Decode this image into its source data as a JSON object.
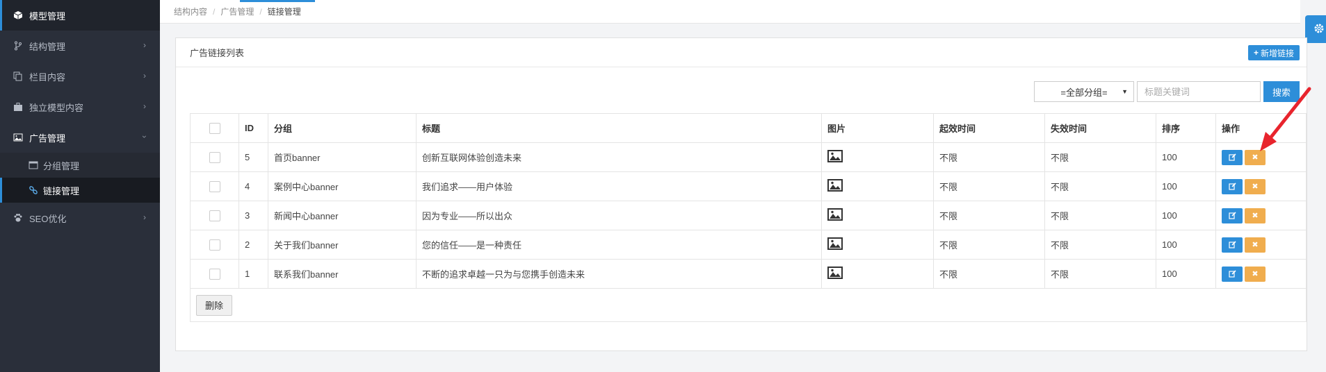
{
  "sidebar": {
    "items": [
      {
        "label": "模型管理",
        "icon": "cube-icon"
      },
      {
        "label": "结构管理",
        "icon": "branch-icon"
      },
      {
        "label": "栏目内容",
        "icon": "copy-icon"
      },
      {
        "label": "独立模型内容",
        "icon": "briefcase-icon"
      },
      {
        "label": "广告管理",
        "icon": "picture-icon"
      },
      {
        "label": "SEO优化",
        "icon": "paw-icon"
      }
    ],
    "sub_items": [
      {
        "label": "分组管理",
        "icon": "window-icon"
      },
      {
        "label": "链接管理",
        "icon": "link-icon"
      }
    ]
  },
  "breadcrumb": [
    "结构内容",
    "广告管理",
    "链接管理"
  ],
  "breadcrumb_sep": "/",
  "panel": {
    "title": "广告链接列表",
    "add_label": "新增链接"
  },
  "filter": {
    "group_selected": "=全部分组=",
    "placeholder": "标题关键词",
    "search_label": "搜索"
  },
  "table": {
    "headers": [
      "ID",
      "分组",
      "标题",
      "图片",
      "起效时间",
      "失效时间",
      "排序",
      "操作"
    ],
    "rows": [
      {
        "id": "5",
        "group": "首页banner",
        "title": "创新互联网体验创造未来",
        "start": "不限",
        "end": "不限",
        "sort": "100"
      },
      {
        "id": "4",
        "group": "案例中心banner",
        "title": "我们追求——用户体验",
        "start": "不限",
        "end": "不限",
        "sort": "100"
      },
      {
        "id": "3",
        "group": "新闻中心banner",
        "title": "因为专业——所以出众",
        "start": "不限",
        "end": "不限",
        "sort": "100"
      },
      {
        "id": "2",
        "group": "关于我们banner",
        "title": "您的信任——是一种责任",
        "start": "不限",
        "end": "不限",
        "sort": "100"
      },
      {
        "id": "1",
        "group": "联系我们banner",
        "title": "不断的追求卓越一只为与您携手创造未来",
        "start": "不限",
        "end": "不限",
        "sort": "100"
      }
    ],
    "delete_label": "删除"
  },
  "colors": {
    "sidebar_bg": "#2a2f3a",
    "accent": "#2d8ed9",
    "warning": "#f0ad4e",
    "annotation_arrow": "#e8242d"
  }
}
